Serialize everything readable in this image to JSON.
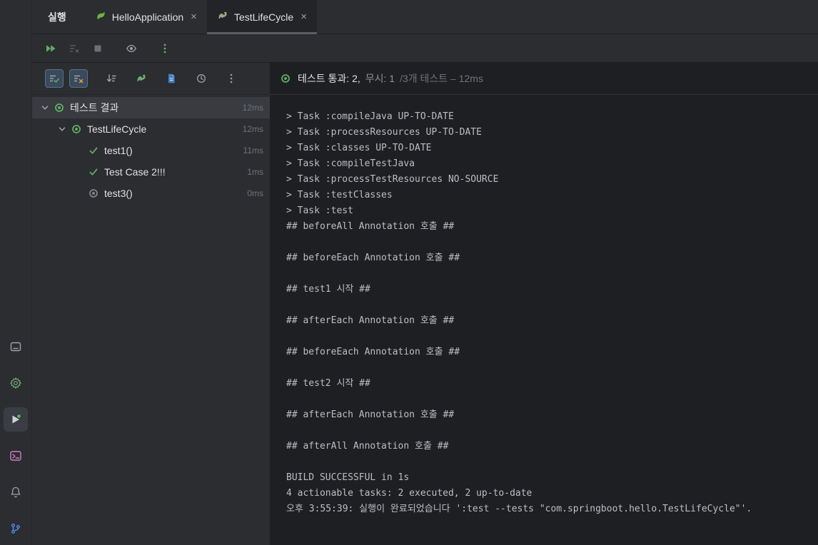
{
  "colors": {
    "green": "#5fad65",
    "spring_green": "#6db33f",
    "orange_x": "#d9a343",
    "document_blue": "#4682c8",
    "terminal_pink": "#d678c9",
    "branch_blue": "#548af7",
    "panel_bg": "#2b2d30",
    "console_bg": "#1e1f22",
    "selected_row_bg": "#393b40"
  },
  "tool_window": {
    "title": "실행"
  },
  "tabs": [
    {
      "label": "HelloApplication",
      "icon": "spring-boot-icon",
      "active": false
    },
    {
      "label": "TestLifeCycle",
      "icon": "gradle-icon",
      "active": true
    }
  ],
  "top_toolbar": {
    "icons": [
      "rerun-tests-icon",
      "rerun-failed-tests-icon",
      "stop-icon",
      "eye-icon",
      "more-options-icon"
    ]
  },
  "panel_toolbar": {
    "icons": [
      "show-passed-icon",
      "show-ignored-icon",
      "sort-by-duration-icon",
      "gradle-icon",
      "export-test-results-icon",
      "test-history-icon",
      "more-options-icon"
    ]
  },
  "status_bar": {
    "passed": "테스트 통과: 2,",
    "ignored": "무시: 1",
    "total": "/3개 테스트 – 12ms"
  },
  "test_tree": {
    "rows": [
      {
        "label": "테스트 결과",
        "time": "12ms",
        "state": "passed",
        "level": 0,
        "expanded": true,
        "selected": true
      },
      {
        "label": "TestLifeCycle",
        "time": "12ms",
        "state": "passed",
        "level": 1,
        "expanded": true,
        "selected": false
      },
      {
        "label": "test1()",
        "time": "11ms",
        "state": "passed",
        "level": 2,
        "selected": false
      },
      {
        "label": "Test Case 2!!!",
        "time": "1ms",
        "state": "passed",
        "level": 2,
        "selected": false
      },
      {
        "label": "test3()",
        "time": "0ms",
        "state": "ignored",
        "level": 2,
        "selected": false
      }
    ]
  },
  "console": {
    "lines": [
      "> Task :compileJava UP-TO-DATE",
      "> Task :processResources UP-TO-DATE",
      "> Task :classes UP-TO-DATE",
      "> Task :compileTestJava",
      "> Task :processTestResources NO-SOURCE",
      "> Task :testClasses",
      "> Task :test",
      "## beforeAll Annotation 호출 ##",
      "",
      "## beforeEach Annotation 호출 ##",
      "",
      "## test1 시작 ##",
      "",
      "## afterEach Annotation 호출 ##",
      "",
      "## beforeEach Annotation 호출 ##",
      "",
      "## test2 시작 ##",
      "",
      "## afterEach Annotation 호출 ##",
      "",
      "## afterAll Annotation 호출 ##",
      "",
      "BUILD SUCCESSFUL in 1s",
      "4 actionable tasks: 2 executed, 2 up-to-date",
      "오후 3:55:39: 실행이 완료되었습니다 ':test --tests \"com.springboot.hello.TestLifeCycle\"'."
    ]
  }
}
